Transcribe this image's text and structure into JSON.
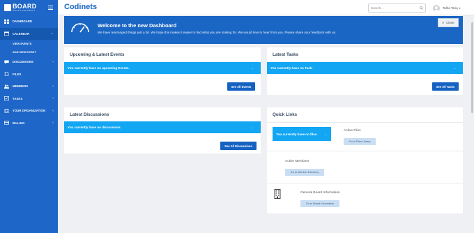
{
  "sidebar": {
    "brand_big": "BOARD",
    "brand_small": "MANAGEMENT",
    "items": [
      {
        "label": "DASHBOARD",
        "icon": "dashboard-icon"
      },
      {
        "label": "CALENDAR",
        "icon": "calendar-icon",
        "expanded": true,
        "sub": [
          "VIEW EVENTS",
          "ADD NEW EVENT"
        ]
      },
      {
        "label": "DISCUSSIONS",
        "icon": "discussions-icon"
      },
      {
        "label": "FILES",
        "icon": "files-icon"
      },
      {
        "label": "MEMBERS",
        "icon": "members-icon"
      },
      {
        "label": "TASKS",
        "icon": "tasks-icon"
      },
      {
        "label": "YOUR ORGANIZATION",
        "icon": "organization-icon"
      },
      {
        "label": "BILLING",
        "icon": "billing-icon"
      }
    ]
  },
  "topbar": {
    "title": "Codinets",
    "search_placeholder": "Search...",
    "user_name": "Talha Tariq"
  },
  "welcome": {
    "title": "Welcome to the new Dashboard",
    "text": "We have rearranged things just a bit. We hope this makes it easier to find what you are looking for. We would love to hear from you. Please share your feedback with us.",
    "close_label": "Close"
  },
  "events": {
    "title": "Upcoming & Latest Events",
    "empty": "You currently have no upcoming Events.",
    "button": "See All Events"
  },
  "tasks": {
    "title": "Latest Tasks",
    "empty": "You currently have no Task.",
    "button": "See All Tasks"
  },
  "discussions": {
    "title": "Latest Discussions",
    "empty": "You currently have no discussions.",
    "button": "See All Discussions"
  },
  "quick_links": {
    "title": "Quick Links",
    "files_empty": "You currently have no files.",
    "active_files": "Active Files",
    "files_button": "Go to Files Library",
    "active_members": "Active Members",
    "members_button": "Go to Member Directory",
    "board_info": "General Board Information",
    "board_button": "Go to Board Information"
  },
  "colors": {
    "primary": "#1a66c4",
    "info": "#12a6f3",
    "sidebar": "#1e66c7"
  }
}
